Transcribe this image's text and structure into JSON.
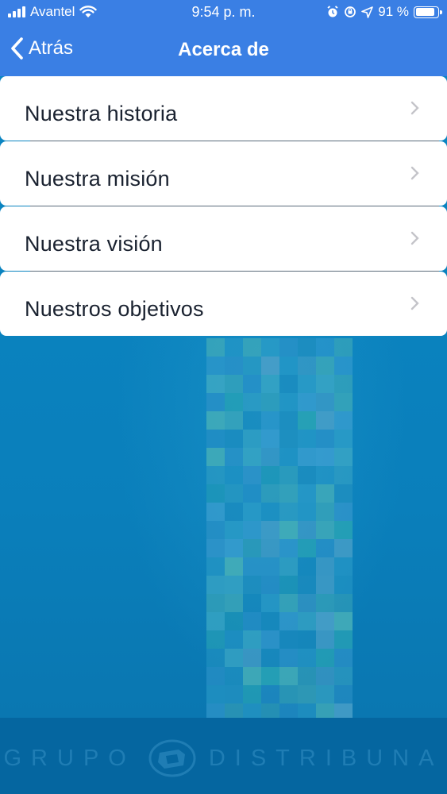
{
  "status_bar": {
    "carrier": "Avantel",
    "time": "9:54 p. m.",
    "battery": "91 %",
    "icons": [
      "signal-icon",
      "wifi-icon",
      "alarm-icon",
      "orientation-lock-icon",
      "location-icon",
      "battery-icon"
    ]
  },
  "nav": {
    "back_label": "Atrás",
    "title": "Acerca de"
  },
  "menu": {
    "items": [
      {
        "label": "Nuestra historia"
      },
      {
        "label": "Nuestra misión"
      },
      {
        "label": "Nuestra visión"
      },
      {
        "label": "Nuestros objetivos"
      }
    ]
  },
  "footer": {
    "brand_left": "GRUPO",
    "brand_right": "DISTRIBUNA"
  },
  "colors": {
    "header": "#3a7fe4",
    "background": "#0a85c2",
    "footer": "#0566a0"
  }
}
